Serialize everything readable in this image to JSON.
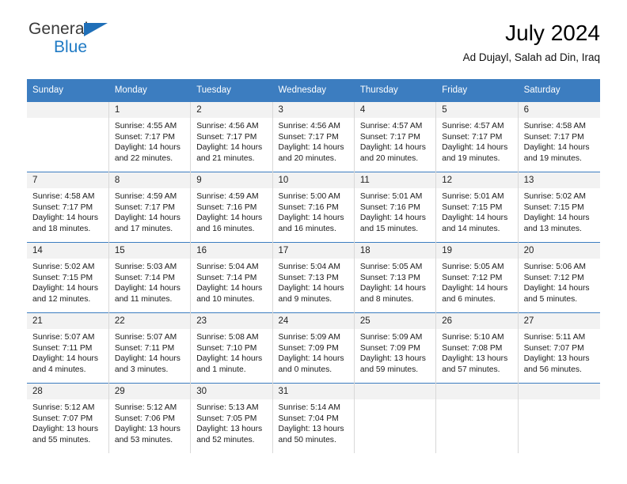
{
  "brand": {
    "name_part1": "General",
    "name_part2": "Blue",
    "flag_color": "#1f6fb8",
    "text_color": "#3a3a3a",
    "accent_color": "#1f7ac4"
  },
  "header": {
    "title": "July 2024",
    "subtitle": "Ad Dujayl, Salah ad Din, Iraq",
    "header_bg": "#3c7dc0"
  },
  "weekday_headers": [
    "Sunday",
    "Monday",
    "Tuesday",
    "Wednesday",
    "Thursday",
    "Friday",
    "Saturday"
  ],
  "weeks": [
    [
      {
        "day": "",
        "empty": true,
        "sunrise": "",
        "sunset": "",
        "daylight1": "",
        "daylight2": ""
      },
      {
        "day": "1",
        "sunrise": "Sunrise: 4:55 AM",
        "sunset": "Sunset: 7:17 PM",
        "daylight1": "Daylight: 14 hours",
        "daylight2": "and 22 minutes."
      },
      {
        "day": "2",
        "sunrise": "Sunrise: 4:56 AM",
        "sunset": "Sunset: 7:17 PM",
        "daylight1": "Daylight: 14 hours",
        "daylight2": "and 21 minutes."
      },
      {
        "day": "3",
        "sunrise": "Sunrise: 4:56 AM",
        "sunset": "Sunset: 7:17 PM",
        "daylight1": "Daylight: 14 hours",
        "daylight2": "and 20 minutes."
      },
      {
        "day": "4",
        "sunrise": "Sunrise: 4:57 AM",
        "sunset": "Sunset: 7:17 PM",
        "daylight1": "Daylight: 14 hours",
        "daylight2": "and 20 minutes."
      },
      {
        "day": "5",
        "sunrise": "Sunrise: 4:57 AM",
        "sunset": "Sunset: 7:17 PM",
        "daylight1": "Daylight: 14 hours",
        "daylight2": "and 19 minutes."
      },
      {
        "day": "6",
        "sunrise": "Sunrise: 4:58 AM",
        "sunset": "Sunset: 7:17 PM",
        "daylight1": "Daylight: 14 hours",
        "daylight2": "and 19 minutes."
      }
    ],
    [
      {
        "day": "7",
        "sunrise": "Sunrise: 4:58 AM",
        "sunset": "Sunset: 7:17 PM",
        "daylight1": "Daylight: 14 hours",
        "daylight2": "and 18 minutes."
      },
      {
        "day": "8",
        "sunrise": "Sunrise: 4:59 AM",
        "sunset": "Sunset: 7:17 PM",
        "daylight1": "Daylight: 14 hours",
        "daylight2": "and 17 minutes."
      },
      {
        "day": "9",
        "sunrise": "Sunrise: 4:59 AM",
        "sunset": "Sunset: 7:16 PM",
        "daylight1": "Daylight: 14 hours",
        "daylight2": "and 16 minutes."
      },
      {
        "day": "10",
        "sunrise": "Sunrise: 5:00 AM",
        "sunset": "Sunset: 7:16 PM",
        "daylight1": "Daylight: 14 hours",
        "daylight2": "and 16 minutes."
      },
      {
        "day": "11",
        "sunrise": "Sunrise: 5:01 AM",
        "sunset": "Sunset: 7:16 PM",
        "daylight1": "Daylight: 14 hours",
        "daylight2": "and 15 minutes."
      },
      {
        "day": "12",
        "sunrise": "Sunrise: 5:01 AM",
        "sunset": "Sunset: 7:15 PM",
        "daylight1": "Daylight: 14 hours",
        "daylight2": "and 14 minutes."
      },
      {
        "day": "13",
        "sunrise": "Sunrise: 5:02 AM",
        "sunset": "Sunset: 7:15 PM",
        "daylight1": "Daylight: 14 hours",
        "daylight2": "and 13 minutes."
      }
    ],
    [
      {
        "day": "14",
        "sunrise": "Sunrise: 5:02 AM",
        "sunset": "Sunset: 7:15 PM",
        "daylight1": "Daylight: 14 hours",
        "daylight2": "and 12 minutes."
      },
      {
        "day": "15",
        "sunrise": "Sunrise: 5:03 AM",
        "sunset": "Sunset: 7:14 PM",
        "daylight1": "Daylight: 14 hours",
        "daylight2": "and 11 minutes."
      },
      {
        "day": "16",
        "sunrise": "Sunrise: 5:04 AM",
        "sunset": "Sunset: 7:14 PM",
        "daylight1": "Daylight: 14 hours",
        "daylight2": "and 10 minutes."
      },
      {
        "day": "17",
        "sunrise": "Sunrise: 5:04 AM",
        "sunset": "Sunset: 7:13 PM",
        "daylight1": "Daylight: 14 hours",
        "daylight2": "and 9 minutes."
      },
      {
        "day": "18",
        "sunrise": "Sunrise: 5:05 AM",
        "sunset": "Sunset: 7:13 PM",
        "daylight1": "Daylight: 14 hours",
        "daylight2": "and 8 minutes."
      },
      {
        "day": "19",
        "sunrise": "Sunrise: 5:05 AM",
        "sunset": "Sunset: 7:12 PM",
        "daylight1": "Daylight: 14 hours",
        "daylight2": "and 6 minutes."
      },
      {
        "day": "20",
        "sunrise": "Sunrise: 5:06 AM",
        "sunset": "Sunset: 7:12 PM",
        "daylight1": "Daylight: 14 hours",
        "daylight2": "and 5 minutes."
      }
    ],
    [
      {
        "day": "21",
        "sunrise": "Sunrise: 5:07 AM",
        "sunset": "Sunset: 7:11 PM",
        "daylight1": "Daylight: 14 hours",
        "daylight2": "and 4 minutes."
      },
      {
        "day": "22",
        "sunrise": "Sunrise: 5:07 AM",
        "sunset": "Sunset: 7:11 PM",
        "daylight1": "Daylight: 14 hours",
        "daylight2": "and 3 minutes."
      },
      {
        "day": "23",
        "sunrise": "Sunrise: 5:08 AM",
        "sunset": "Sunset: 7:10 PM",
        "daylight1": "Daylight: 14 hours",
        "daylight2": "and 1 minute."
      },
      {
        "day": "24",
        "sunrise": "Sunrise: 5:09 AM",
        "sunset": "Sunset: 7:09 PM",
        "daylight1": "Daylight: 14 hours",
        "daylight2": "and 0 minutes."
      },
      {
        "day": "25",
        "sunrise": "Sunrise: 5:09 AM",
        "sunset": "Sunset: 7:09 PM",
        "daylight1": "Daylight: 13 hours",
        "daylight2": "and 59 minutes."
      },
      {
        "day": "26",
        "sunrise": "Sunrise: 5:10 AM",
        "sunset": "Sunset: 7:08 PM",
        "daylight1": "Daylight: 13 hours",
        "daylight2": "and 57 minutes."
      },
      {
        "day": "27",
        "sunrise": "Sunrise: 5:11 AM",
        "sunset": "Sunset: 7:07 PM",
        "daylight1": "Daylight: 13 hours",
        "daylight2": "and 56 minutes."
      }
    ],
    [
      {
        "day": "28",
        "sunrise": "Sunrise: 5:12 AM",
        "sunset": "Sunset: 7:07 PM",
        "daylight1": "Daylight: 13 hours",
        "daylight2": "and 55 minutes."
      },
      {
        "day": "29",
        "sunrise": "Sunrise: 5:12 AM",
        "sunset": "Sunset: 7:06 PM",
        "daylight1": "Daylight: 13 hours",
        "daylight2": "and 53 minutes."
      },
      {
        "day": "30",
        "sunrise": "Sunrise: 5:13 AM",
        "sunset": "Sunset: 7:05 PM",
        "daylight1": "Daylight: 13 hours",
        "daylight2": "and 52 minutes."
      },
      {
        "day": "31",
        "sunrise": "Sunrise: 5:14 AM",
        "sunset": "Sunset: 7:04 PM",
        "daylight1": "Daylight: 13 hours",
        "daylight2": "and 50 minutes."
      },
      {
        "day": "",
        "empty": true,
        "sunrise": "",
        "sunset": "",
        "daylight1": "",
        "daylight2": ""
      },
      {
        "day": "",
        "empty": true,
        "sunrise": "",
        "sunset": "",
        "daylight1": "",
        "daylight2": ""
      },
      {
        "day": "",
        "empty": true,
        "sunrise": "",
        "sunset": "",
        "daylight1": "",
        "daylight2": ""
      }
    ]
  ]
}
